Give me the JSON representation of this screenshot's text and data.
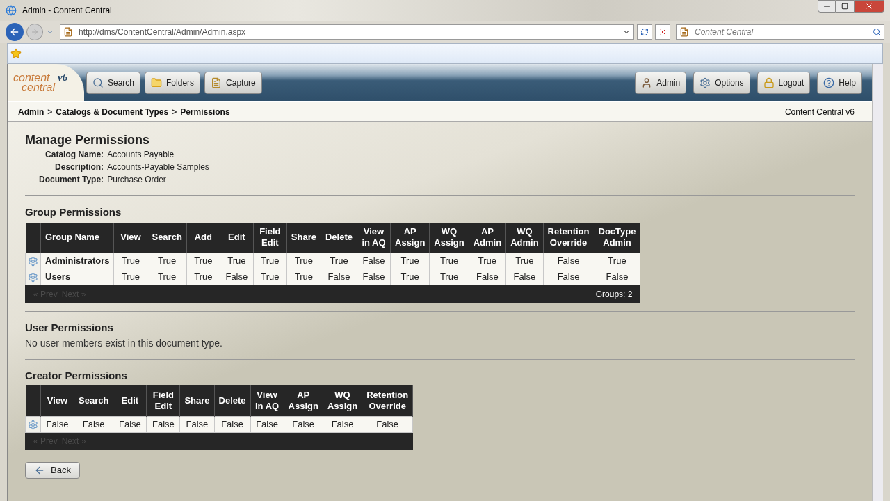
{
  "window": {
    "title": "Admin - Content Central"
  },
  "browser": {
    "address": "http://dms/ContentCentral/Admin/Admin.aspx",
    "search_placeholder": "Content Central"
  },
  "logo": {
    "line_1": "content",
    "line_2": "central",
    "version": "v6"
  },
  "nav_left": [
    {
      "label": "Search",
      "kind": "search"
    },
    {
      "label": "Folders",
      "kind": "folder"
    },
    {
      "label": "Capture",
      "kind": "capture"
    }
  ],
  "nav_right": [
    {
      "label": "Admin",
      "kind": "user"
    },
    {
      "label": "Options",
      "kind": "gear"
    },
    {
      "label": "Logout",
      "kind": "lock"
    },
    {
      "label": "Help",
      "kind": "help"
    }
  ],
  "breadcrumb": [
    {
      "kind": "link",
      "text": "Admin"
    },
    {
      "kind": "separator",
      "text": ">"
    },
    {
      "kind": "link",
      "text": "Catalogs & Document Types"
    },
    {
      "kind": "separator",
      "text": ">"
    },
    {
      "kind": "link",
      "text": "Permissions"
    }
  ],
  "product_version": "Content Central v6",
  "page_title": "Manage Permissions",
  "details": [
    {
      "label": "Catalog Name:",
      "value": "Accounts Payable"
    },
    {
      "label": "Description:",
      "value": "Accounts-Payable Samples"
    },
    {
      "label": "Document Type:",
      "value": "Purchase Order"
    }
  ],
  "group_permissions": {
    "title": "Group Permissions",
    "columns": [
      "Group Name",
      "View",
      "Search",
      "Add",
      "Edit",
      "Field Edit",
      "Share",
      "Delete",
      "View in AQ",
      "AP Assign",
      "WQ Assign",
      "AP Admin",
      "WQ Admin",
      "Retention Override",
      "DocType Admin"
    ],
    "rows": [
      [
        "Administrators",
        "True",
        "True",
        "True",
        "True",
        "True",
        "True",
        "True",
        "False",
        "True",
        "True",
        "True",
        "True",
        "False",
        "True"
      ],
      [
        "Users",
        "True",
        "True",
        "True",
        "False",
        "True",
        "True",
        "False",
        "False",
        "True",
        "True",
        "False",
        "False",
        "False",
        "False"
      ]
    ],
    "pager": {
      "prev": "« Prev",
      "next": "Next »",
      "disabled": true
    },
    "count": "Groups: 2"
  },
  "user_permissions": {
    "title": "User Permissions",
    "message": "No user members exist in this document type."
  },
  "creator_permissions": {
    "title": "Creator Permissions",
    "columns": [
      "View",
      "Search",
      "Edit",
      "Field Edit",
      "Share",
      "Delete",
      "View in AQ",
      "AP Assign",
      "WQ Assign",
      "Retention Override"
    ],
    "rows": [
      [
        "False",
        "False",
        "False",
        "False",
        "False",
        "False",
        "False",
        "False",
        "False",
        "False"
      ]
    ],
    "pager": {
      "prev": "« Prev",
      "next": "Next »",
      "disabled": true
    }
  },
  "back_button": "Back"
}
